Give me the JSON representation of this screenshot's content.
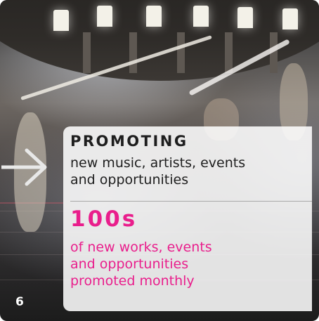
{
  "panel": {
    "heading": "PROMOTING",
    "subheading_line1": "new music, artists, events",
    "subheading_line2": "and opportunities",
    "stat_value": "100s",
    "stat_line1": "of new works, events",
    "stat_line2": "and opportunities",
    "stat_line3": "promoted monthly"
  },
  "page_number": "6",
  "icons": {
    "arrow": "arrow-right-icon"
  },
  "colors": {
    "accent": "#e91e8c",
    "text_dark": "#1e1e1e",
    "panel_bg": "rgba(255,255,255,0.87)"
  }
}
